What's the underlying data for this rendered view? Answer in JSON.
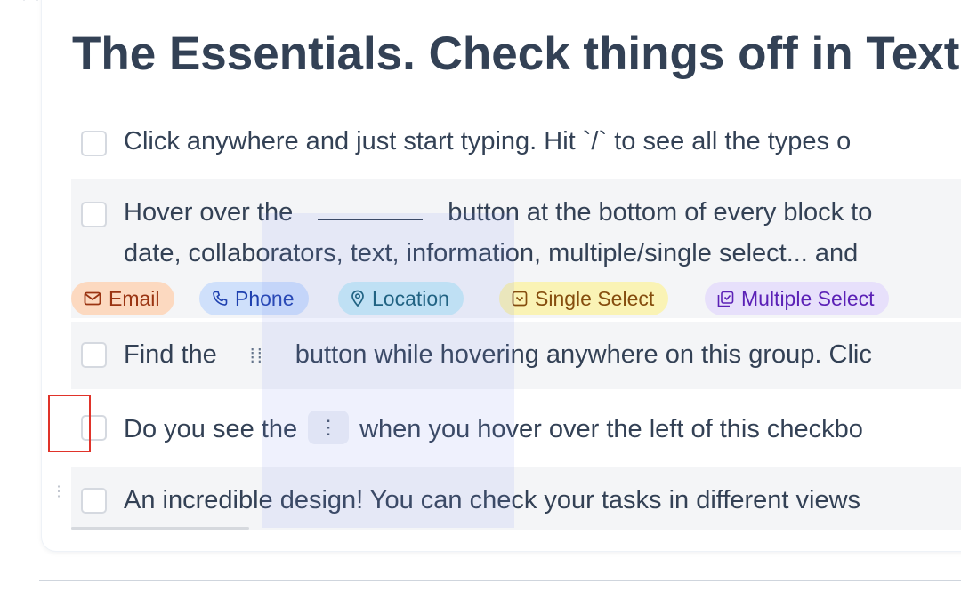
{
  "title": "The Essentials. Check things off in Text",
  "tasks": [
    {
      "text": "Click anywhere and just start typing. Hit `/` to see all the types o",
      "checked": false
    },
    {
      "text_before": "Hover over the",
      "text_after": "button at the bottom of every block to",
      "line2": "date, collaborators, text, information, multiple/single select... and",
      "checked": false
    },
    {
      "text_before": "Find the",
      "text_after": "button while hovering anywhere on this group. Clic",
      "checked": false
    },
    {
      "text_before": "Do you see the",
      "text_after": "when you hover over the left of this checkbo",
      "checked": false
    },
    {
      "text": "An incredible design! You can check your tasks in different views",
      "checked": false
    }
  ],
  "field_chips": [
    {
      "label": "Email",
      "icon": "envelope-icon",
      "bg": "#fcd9c0",
      "color": "#9a3412"
    },
    {
      "label": "Phone",
      "icon": "phone-icon",
      "bg": "#cfe0fb",
      "color": "#1e40af"
    },
    {
      "label": "Location",
      "icon": "location-pin-icon",
      "bg": "#c9ecf5",
      "color": "#155e75"
    },
    {
      "label": "Single Select",
      "icon": "single-select-icon",
      "bg": "#faf3b5",
      "color": "#854d0e"
    },
    {
      "label": "Multiple Select",
      "icon": "multiple-select-icon",
      "bg": "#e7e0fb",
      "color": "#5b21b6"
    }
  ],
  "colors": {
    "text": "#334155",
    "row_shade": "#f4f5f7",
    "highlight": "#e0332a",
    "drag_overlay": "#788ceb"
  }
}
